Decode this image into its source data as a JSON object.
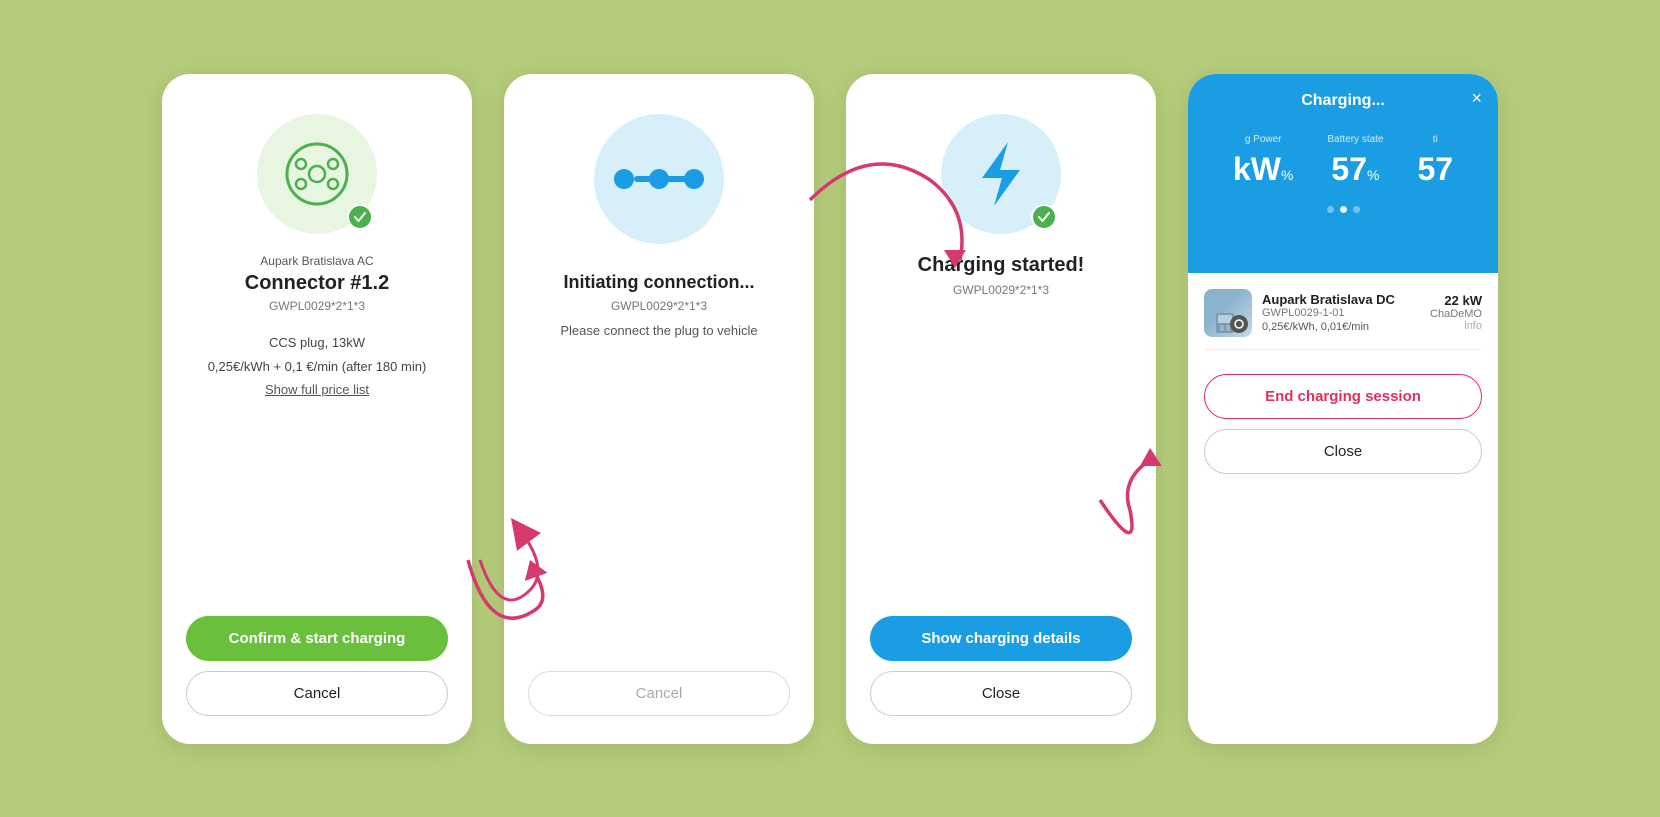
{
  "background_color": "#b5cc7a",
  "screen1": {
    "station_name": "Aupark Bratislava AC",
    "connector_title": "Connector #1.2",
    "connector_id": "GWPL0029*2*1*3",
    "plug_type": "CCS plug, 13kW",
    "price_info": "0,25€/kWh + 0,1 €/min (after 180 min)",
    "show_price_label": "Show full price list",
    "confirm_btn": "Confirm & start charging",
    "cancel_btn": "Cancel"
  },
  "screen2": {
    "title": "Initiating connection...",
    "id": "GWPL0029*2*1*3",
    "description": "Please connect the plug to vehicle",
    "cancel_btn": "Cancel"
  },
  "screen3": {
    "title": "Charging started!",
    "id": "GWPL0029*2*1*3",
    "show_details_btn": "Show charging details",
    "close_btn": "Close"
  },
  "screen4": {
    "header_title": "Charging...",
    "close_btn": "×",
    "stat1_label": "g Power",
    "stat1_value": "kW",
    "stat1_unit": "%",
    "stat2_label": "Battery state",
    "stat2_value": "57",
    "stat2_unit": "%",
    "stat3_label": "ti",
    "stat3_value": "57",
    "dots": [
      false,
      true,
      false
    ],
    "station_name": "Aupark Bratislava DC",
    "station_power": "22 kW",
    "station_id": "GWPL0029-1-01",
    "station_type": "ChaDeMO",
    "station_price": "0,25€/kWh, 0,01€/min",
    "station_link": "info",
    "end_session_btn": "End charging session",
    "close_btn2": "Close"
  }
}
